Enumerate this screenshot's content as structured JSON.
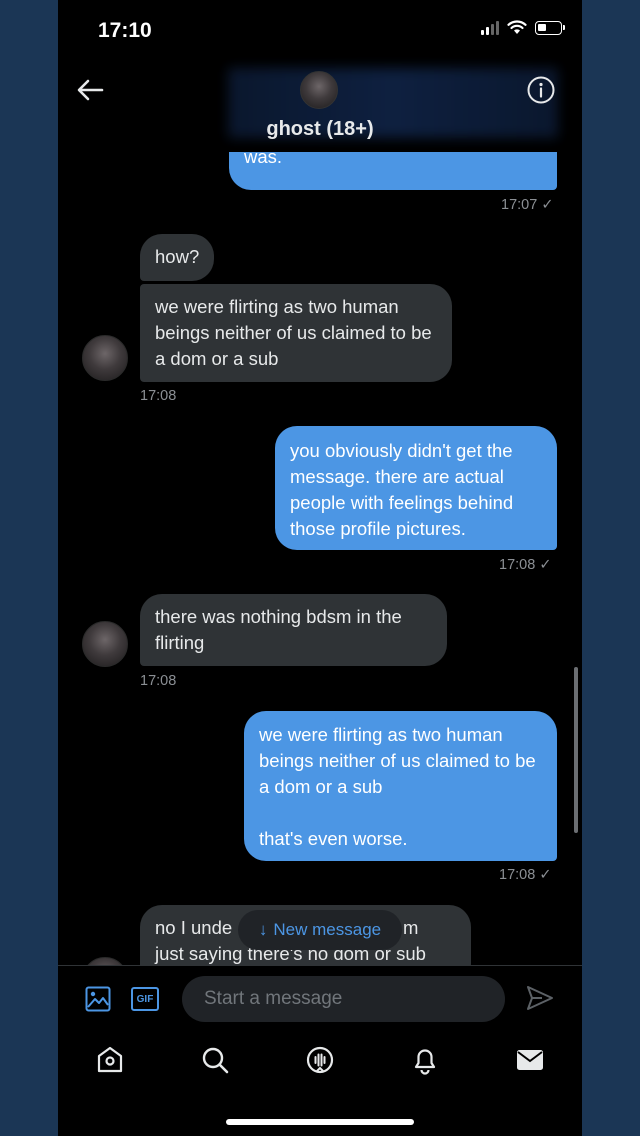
{
  "status_bar": {
    "time": "17:10"
  },
  "header": {
    "title": "ghost (18+)"
  },
  "messages": [
    {
      "dir": "out",
      "text": "was."
    },
    {
      "dir": "out_time",
      "text": "17:07 ✓"
    },
    {
      "dir": "in",
      "text": "how?"
    },
    {
      "dir": "in",
      "text": "we were flirting as two human beings neither of us claimed to be a dom or a sub"
    },
    {
      "dir": "in_time",
      "text": "17:08"
    },
    {
      "dir": "out",
      "text": "you obviously didn't get the message. there are actual people with feelings behind those profile pictures."
    },
    {
      "dir": "out_time",
      "text": "17:08 ✓"
    },
    {
      "dir": "in",
      "text": "there was nothing bdsm in the flirting"
    },
    {
      "dir": "in_time",
      "text": "17:08"
    },
    {
      "dir": "out",
      "text": "we were flirting as two human beings neither of us claimed to be a dom or a sub\n\nthat's even worse."
    },
    {
      "dir": "out_time",
      "text": "17:08 ✓"
    },
    {
      "dir": "in_partial_1",
      "text": "no I unde"
    },
    {
      "dir": "in_partial_2",
      "text": "m"
    },
    {
      "dir": "in_partial_3",
      "text": "just saying there's no dom or sub"
    }
  ],
  "new_message_pill": {
    "arrow": "↓",
    "label": "New message"
  },
  "composer": {
    "placeholder": "Start a message",
    "gif_label": "GIF"
  },
  "tabs": [
    {
      "name": "home",
      "icon": "home-icon"
    },
    {
      "name": "search",
      "icon": "search-icon"
    },
    {
      "name": "spaces",
      "icon": "spaces-icon"
    },
    {
      "name": "notifications",
      "icon": "bell-icon"
    },
    {
      "name": "messages",
      "icon": "mail-icon"
    }
  ],
  "colors": {
    "accent": "#4c96e4",
    "incoming_bubble": "#2f3336",
    "background": "#000000",
    "frame": "#1b3655"
  }
}
